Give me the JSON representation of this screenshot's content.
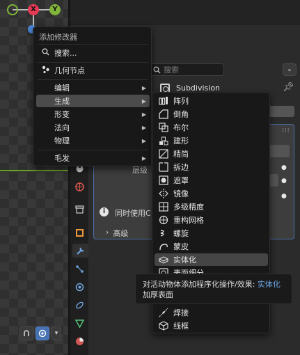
{
  "viewport": {
    "gizmo": {
      "x_label": "X",
      "y_label": "Y",
      "x_color": "#e63a55",
      "y_color": "#80b43a",
      "z_color": "#4b86d6"
    }
  },
  "properties": {
    "search_placeholder": "搜索",
    "modifier_name": "Subdivision",
    "panel_label": "层级",
    "info_text": "同时使用C",
    "advanced_label": "高级"
  },
  "add_modifier_menu": {
    "title": "添加修改器",
    "search_label": "搜索...",
    "geometry_nodes_label": "几何节点",
    "categories": [
      {
        "label": "编辑",
        "active": false
      },
      {
        "label": "生成",
        "active": true
      },
      {
        "label": "形变",
        "active": false
      },
      {
        "label": "法向",
        "active": false
      },
      {
        "label": "物理",
        "active": false
      }
    ],
    "hair_label": "毛发"
  },
  "generate_submenu": {
    "items": [
      {
        "label": "阵列",
        "icon": "array-icon"
      },
      {
        "label": "倒角",
        "icon": "bevel-icon"
      },
      {
        "label": "布尔",
        "icon": "boolean-icon"
      },
      {
        "label": "建形",
        "icon": "build-icon"
      },
      {
        "label": "精简",
        "icon": "decimate-icon"
      },
      {
        "label": "拆边",
        "icon": "edge-split-icon"
      },
      {
        "label": "遮罩",
        "icon": "mask-icon"
      },
      {
        "label": "镜像",
        "icon": "mirror-icon"
      },
      {
        "label": "多级精度",
        "icon": "multires-icon"
      },
      {
        "label": "重构网格",
        "icon": "remesh-icon"
      },
      {
        "label": "螺旋",
        "icon": "screw-icon"
      },
      {
        "label": "蒙皮",
        "icon": "skin-icon"
      },
      {
        "label": "实体化",
        "icon": "solidify-icon",
        "active": true
      },
      {
        "label": "表面细分",
        "icon": "subdivision-icon"
      },
      {
        "label": "焊接",
        "icon": "weld-icon"
      },
      {
        "label": "线框",
        "icon": "wireframe-icon"
      }
    ]
  },
  "tooltip": {
    "text": "对活动物体添加程序化操作/效果: ",
    "highlight": "实体化",
    "line2": "加厚表面"
  },
  "colors": {
    "accent": "#4772b3",
    "menu_bg": "#181818",
    "tooltip_highlight": "#6ea9e8"
  }
}
